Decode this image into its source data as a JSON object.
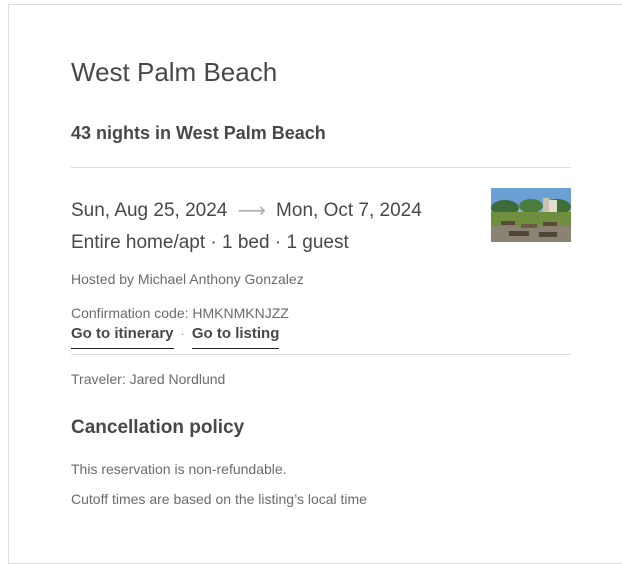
{
  "listing": {
    "city_title": "West Palm Beach",
    "nights_summary": "43 nights in West Palm Beach",
    "check_in": "Sun, Aug 25, 2024",
    "arrow": "⟶",
    "check_out": "Mon, Oct 7, 2024",
    "room_summary": "Entire home/apt · 1 bed · 1 guest",
    "host_line": "Hosted by Michael Anthony Gonzalez",
    "confirmation_line": "Confirmation code: HMKNMKNJZZ",
    "thumbnail_icon": "listing-photo"
  },
  "actions": {
    "itinerary_label": "Go to itinerary",
    "separator": "·",
    "listing_label": "Go to listing"
  },
  "traveler": {
    "line": "Traveler: Jared Nordlund"
  },
  "cancellation": {
    "title": "Cancellation policy",
    "policy_text": "This reservation is non-refundable.",
    "cutoff_text": "Cutoff times are based on the listing’s local time"
  },
  "colors": {
    "text_dark": "#484848",
    "text_muted": "#6b6b6b",
    "divider": "#dddddd"
  }
}
